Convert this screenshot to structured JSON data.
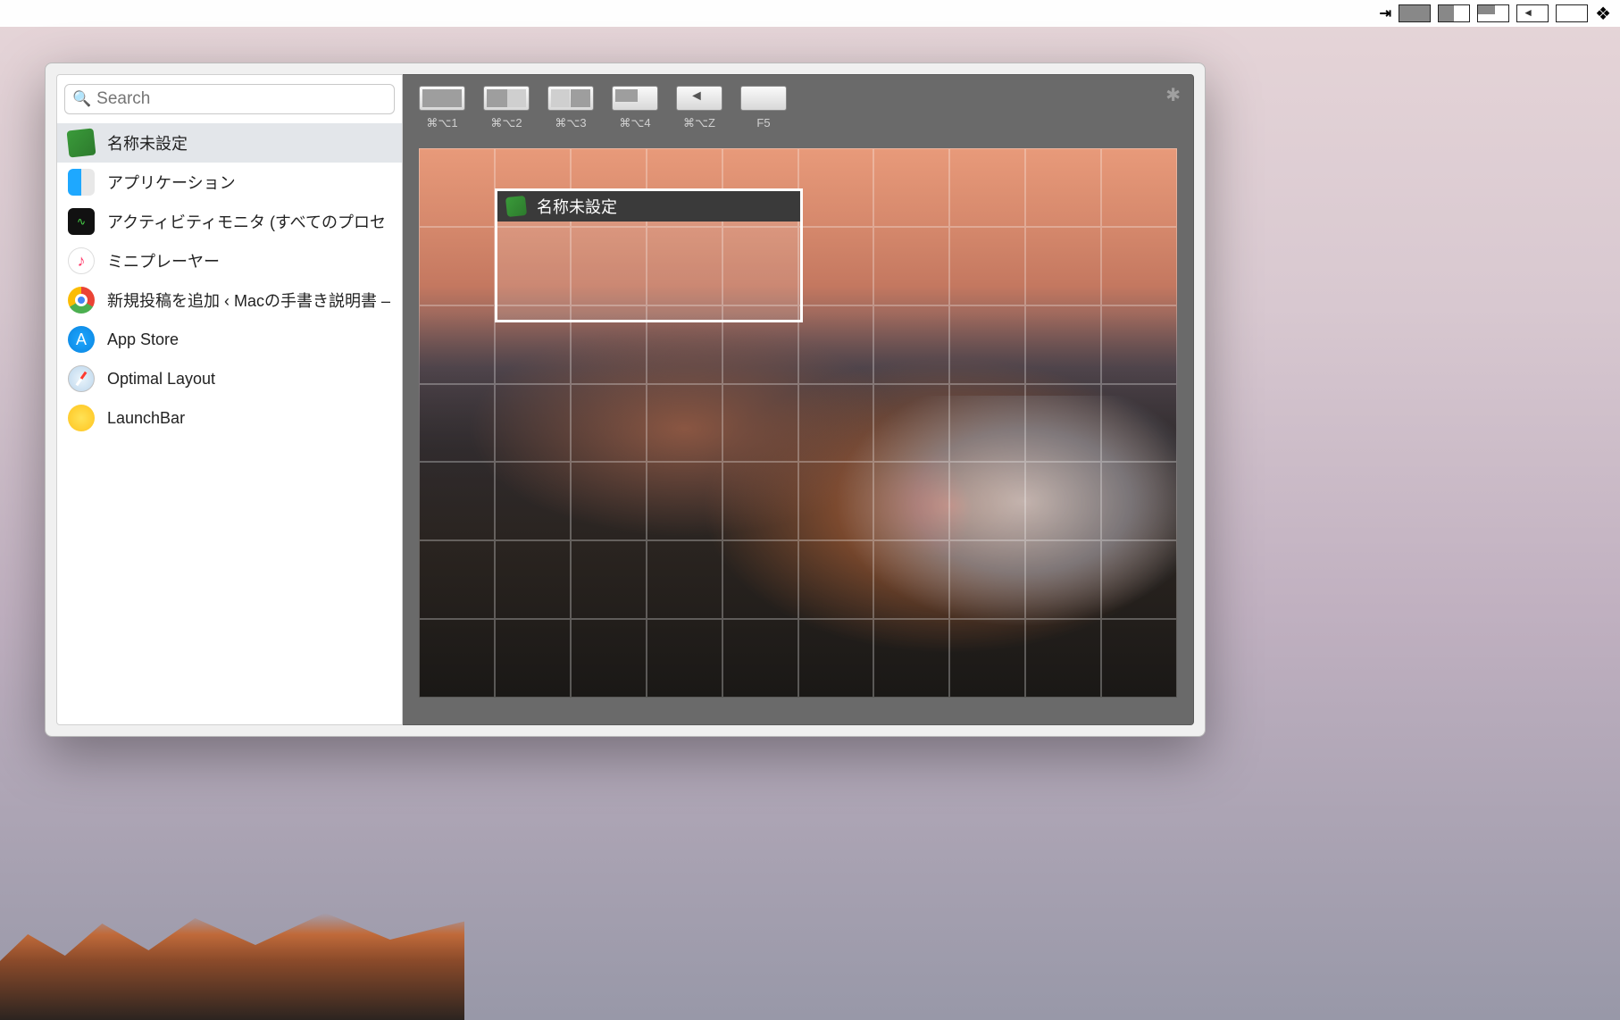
{
  "menubar": {
    "items": [
      "arrow-to-bar",
      "full",
      "half",
      "corner",
      "undo",
      "blank",
      "dropbox"
    ]
  },
  "search": {
    "placeholder": "Search"
  },
  "sidebar": {
    "items": [
      {
        "icon": "textedit",
        "label": "名称未設定",
        "selected": true
      },
      {
        "icon": "finder",
        "label": "アプリケーション"
      },
      {
        "icon": "activity",
        "label": "アクティビティモニタ (すべてのプロセ"
      },
      {
        "icon": "music",
        "label": "ミニプレーヤー"
      },
      {
        "icon": "chrome",
        "label": "新規投稿を追加 ‹ Macの手書き説明書 –"
      },
      {
        "icon": "appstore",
        "label": "App Store"
      },
      {
        "icon": "safari",
        "label": "Optimal Layout"
      },
      {
        "icon": "launchbar",
        "label": "LaunchBar"
      }
    ]
  },
  "toolbar": {
    "buttons": [
      {
        "kind": "full",
        "shortcut": "⌘⌥1"
      },
      {
        "kind": "half",
        "shortcut": "⌘⌥2"
      },
      {
        "kind": "halfr",
        "shortcut": "⌘⌥3"
      },
      {
        "kind": "corner",
        "shortcut": "⌘⌥4"
      },
      {
        "kind": "undo",
        "shortcut": "⌘⌥Z"
      },
      {
        "kind": "blank",
        "shortcut": "F5"
      }
    ]
  },
  "preview": {
    "selected_window_title": "名称未設定"
  }
}
